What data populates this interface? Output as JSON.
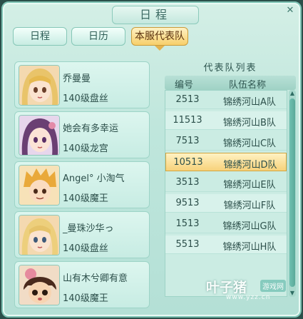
{
  "window": {
    "title": "日程"
  },
  "tabs": [
    {
      "label": "日程",
      "active": false
    },
    {
      "label": "日历",
      "active": false
    },
    {
      "label": "本服代表队",
      "active": true
    }
  ],
  "members": [
    {
      "name": "乔曼曼",
      "level": "140级盘丝",
      "avatar": "female-blonde-avatar"
    },
    {
      "name": "她会有多幸运",
      "level": "140级龙宫",
      "avatar": "female-purple-hair-avatar"
    },
    {
      "name": "Angel° 小淘气",
      "level": "140级魔王",
      "avatar": "male-blonde-avatar"
    },
    {
      "name": "_曼珠沙华っ",
      "level": "140级盘丝",
      "avatar": "female-blonde-avatar"
    },
    {
      "name": "山有木兮卿有意",
      "level": "140级魔王",
      "avatar": "chibi-dark-hair-avatar"
    }
  ],
  "team_list": {
    "title": "代表队列表",
    "columns": [
      "编号",
      "队伍名称"
    ],
    "rows": [
      {
        "id": "2513",
        "name": "锦绣河山A队"
      },
      {
        "id": "11513",
        "name": "锦绣河山B队"
      },
      {
        "id": "7513",
        "name": "锦绣河山C队"
      },
      {
        "id": "10513",
        "name": "锦绣河山D队",
        "selected": true
      },
      {
        "id": "3513",
        "name": "锦绣河山E队"
      },
      {
        "id": "9513",
        "name": "锦绣河山F队"
      },
      {
        "id": "1513",
        "name": "锦绣河山G队"
      },
      {
        "id": "5513",
        "name": "锦绣河山H队"
      }
    ]
  },
  "watermark": {
    "brand": "叶子猪",
    "tag": "游戏网",
    "url": "www.yzz.cn"
  },
  "colors": {
    "accent": "#f7cf6a",
    "panel": "#c7ece3",
    "text": "#2c4f4a"
  }
}
